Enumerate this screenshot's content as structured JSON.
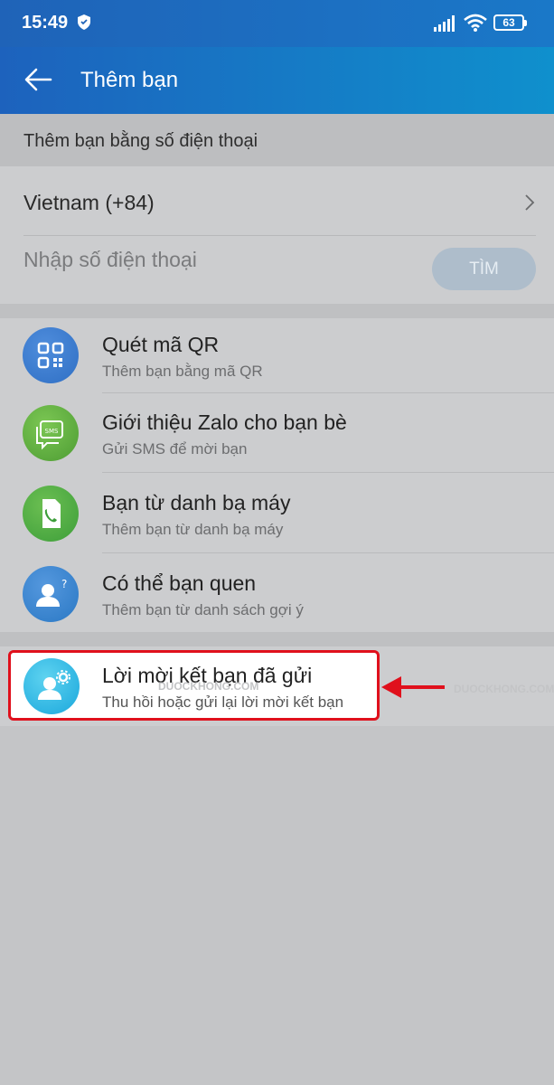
{
  "status_bar": {
    "time": "15:49",
    "battery": "63",
    "icons": [
      "shield-icon",
      "signal-icon",
      "wifi-icon",
      "battery-icon"
    ]
  },
  "app_bar": {
    "title": "Thêm bạn",
    "back_icon": "arrow-left-icon"
  },
  "phone_section": {
    "header": "Thêm bạn bằng số điện thoại",
    "country": "Vietnam (+84)",
    "phone_placeholder": "Nhập số điện thoại",
    "search_button": "TÌM"
  },
  "menu": {
    "items": [
      {
        "title": "Quét mã QR",
        "subtitle": "Thêm bạn bằng mã QR",
        "icon": "qr-code-icon",
        "color": "#2f6fc4"
      },
      {
        "title": "Giới thiệu Zalo cho bạn bè",
        "subtitle": "Gửi SMS để mời bạn",
        "icon": "sms-icon",
        "color": "#52a83a"
      },
      {
        "title": "Bạn từ danh bạ máy",
        "subtitle": "Thêm bạn từ danh bạ máy",
        "icon": "phone-contact-icon",
        "color": "#3d9e3a"
      },
      {
        "title": "Có thể bạn quen",
        "subtitle": "Thêm bạn từ danh sách gợi ý",
        "icon": "person-question-icon",
        "color": "#2a78c4"
      }
    ]
  },
  "sent_requests": {
    "title": "Lời mời kết bạn đã gửi",
    "subtitle": "Thu hồi hoặc gửi lại lời mời kết bạn",
    "icon": "person-gear-icon",
    "highlight_color": "#e0101c"
  },
  "watermark": "DUOCKHONG.COM"
}
